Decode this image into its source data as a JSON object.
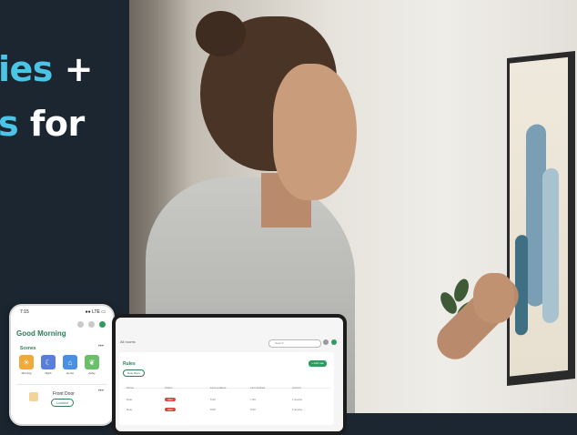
{
  "headline": {
    "line1_accent": "ies",
    "line1_white": " +",
    "line2_accent": "s",
    "line2_white": " for"
  },
  "phone": {
    "time": "7:15",
    "status_right": "●● LTE ▭",
    "greeting": "Good Morning",
    "scenes_label": "Scenes",
    "more": "•••",
    "scenes": [
      {
        "name": "Morning",
        "color": "#f0a93a",
        "icon": "sun-icon"
      },
      {
        "name": "Night",
        "color": "#5a7fd8",
        "icon": "moon-icon"
      },
      {
        "name": "Home",
        "color": "#4a90e2",
        "icon": "home-icon"
      },
      {
        "name": "Away",
        "color": "#6abf69",
        "icon": "leaf-icon"
      }
    ],
    "device": {
      "name": "Front Door",
      "action": "Locked",
      "icon": "lock-icon"
    }
  },
  "tablet": {
    "title": "All rooms",
    "search_placeholder": "Search",
    "section": "Rules",
    "chip": "Rule filters",
    "add_button": "+ Add rule",
    "columns": [
      "Name",
      "Status",
      "Last updated",
      "Last applied",
      "Actions"
    ],
    "rows": [
      {
        "name": "Rule",
        "status": "Alert",
        "updated": "5:00",
        "applied": "7:00",
        "action": "1 device"
      },
      {
        "name": "Rule",
        "status": "Alert",
        "updated": "8:00",
        "applied": "6:00",
        "action": "1 device"
      }
    ]
  },
  "colors": {
    "accent": "#4cc4e6",
    "dark_panel": "#1b2630",
    "brand_green": "#2e9c5f",
    "status_red": "#d9443b"
  }
}
